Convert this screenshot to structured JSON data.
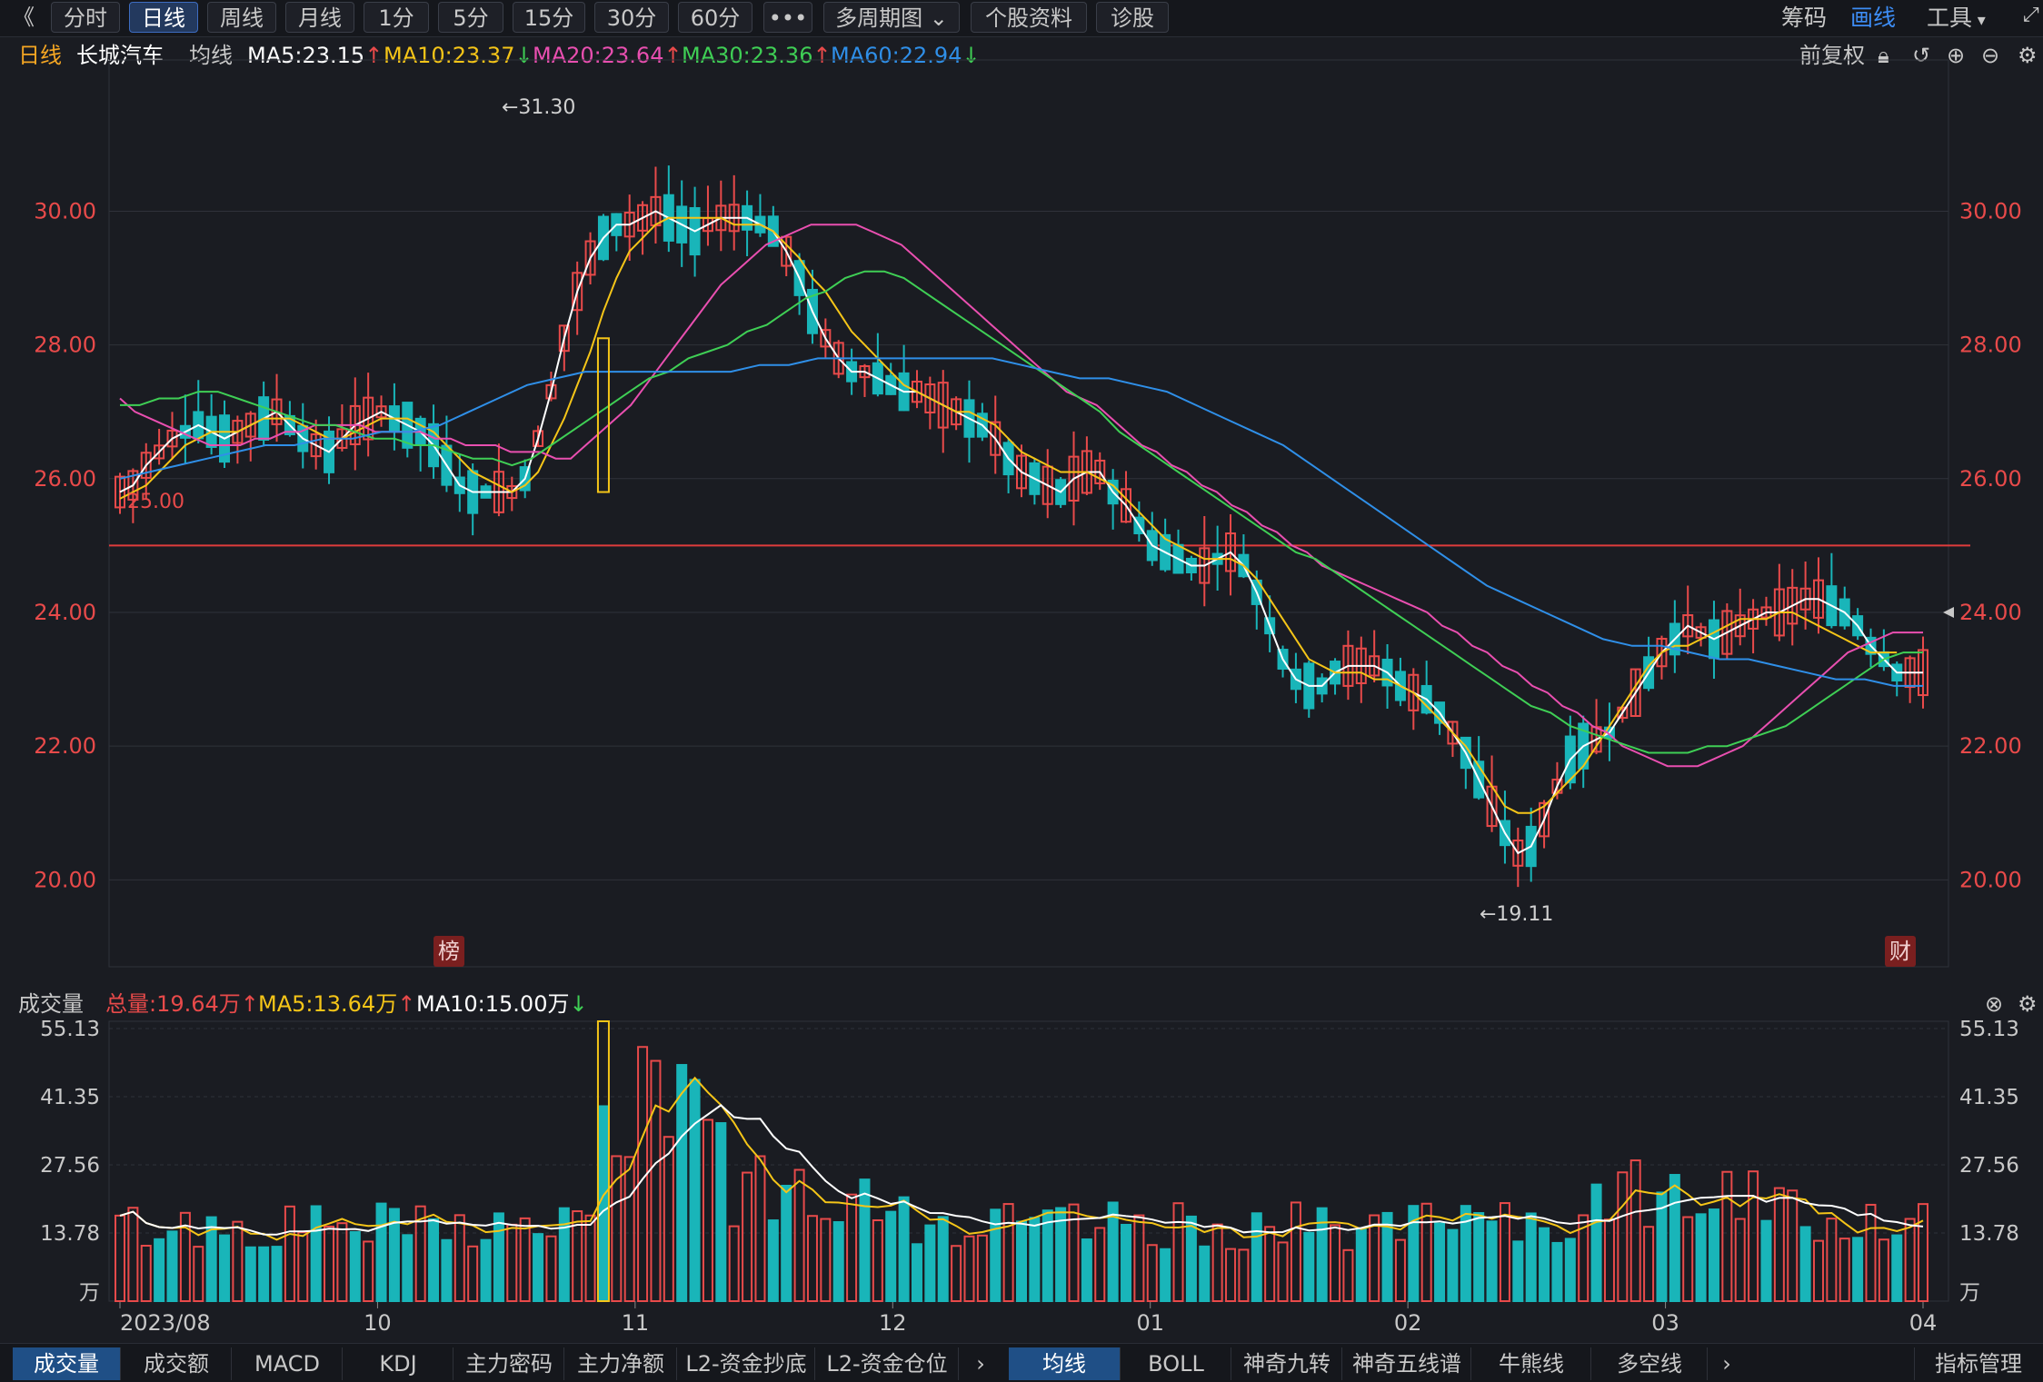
{
  "toolbar": {
    "back_icon": "double-chevron-left-icon",
    "periods": [
      "分时",
      "日线",
      "周线",
      "月线",
      "1分",
      "5分",
      "15分",
      "30分",
      "60分"
    ],
    "active_period": "日线",
    "more_label": "•••",
    "multi_period": "多周期图",
    "stock_info": "个股资料",
    "diagnose": "诊股",
    "right": {
      "chips": "筹码",
      "draw": "画线",
      "tools": "工具"
    }
  },
  "info": {
    "period": "日线",
    "stock_name": "长城汽车",
    "ma_label": "均线",
    "ma5": "MA5:23.15",
    "ma10": "MA10:23.37",
    "ma20": "MA20:23.64",
    "ma30": "MA30:23.36",
    "ma60": "MA60:22.94",
    "adjust": "前复权"
  },
  "price_panel": {
    "hline_label": "25.00",
    "high_label": "←31.30",
    "low_label": "←19.11",
    "badge_rank": "榜",
    "badge_fin": "财"
  },
  "volume_header": {
    "title": "成交量",
    "total": "总量:19.64万",
    "ma5": "MA5:13.64万",
    "ma10": "MA10:15.00万"
  },
  "colors": {
    "up": "#e84a4a",
    "down": "#19b5b9",
    "ma5": "#ffffff",
    "ma10": "#f5c518",
    "ma20": "#e94fb0",
    "ma30": "#3fcf55",
    "ma60": "#2f8fe8",
    "grid": "#2f323a"
  },
  "chart_data": [
    {
      "type": "candlestick",
      "title": "长城汽车 日线",
      "ylim": [
        18.7,
        31.8
      ],
      "y_ticks": [
        "30.00",
        "28.00",
        "26.00",
        "24.00",
        "22.00",
        "20.00"
      ],
      "x_ticks": [
        "2023/08",
        "10",
        "11",
        "12",
        "01",
        "02",
        "03",
        "04"
      ],
      "reference_line": 25.0,
      "annotations": {
        "high": 31.3,
        "low": 19.11
      },
      "series": [
        {
          "name": "MA5",
          "values": [
            25.8,
            25.9,
            26.2,
            26.4,
            26.6,
            26.7,
            26.8,
            26.7,
            26.6,
            26.7,
            26.8,
            26.9,
            27.0,
            26.8,
            26.6,
            26.5,
            26.4,
            26.6,
            26.8,
            26.9,
            27.0,
            26.9,
            26.8,
            26.7,
            26.5,
            26.2,
            25.9,
            25.8,
            25.8,
            25.8,
            25.8,
            26.0,
            26.6,
            27.3,
            28.1,
            28.8,
            29.3,
            29.6,
            29.8,
            29.8,
            29.9,
            30.0,
            29.9,
            29.8,
            29.7,
            29.8,
            29.9,
            29.9,
            29.9,
            29.8,
            29.7,
            29.4,
            29.0,
            28.5,
            28.1,
            27.8,
            27.6,
            27.6,
            27.5,
            27.4,
            27.3,
            27.3,
            27.2,
            27.1,
            27.0,
            26.9,
            26.8,
            26.6,
            26.3,
            26.1,
            26.0,
            25.9,
            25.8,
            26.0,
            26.1,
            26.1,
            25.8,
            25.6,
            25.3,
            25.0,
            24.9,
            24.8,
            24.7,
            24.7,
            24.8,
            24.9,
            24.7,
            24.3,
            23.8,
            23.3,
            23.0,
            22.9,
            22.9,
            23.1,
            23.2,
            23.2,
            23.2,
            23.1,
            22.9,
            22.8,
            22.7,
            22.5,
            22.2,
            21.9,
            21.5,
            21.1,
            20.7,
            20.4,
            20.5,
            20.9,
            21.4,
            21.8,
            22.0,
            22.1,
            22.2,
            22.5,
            22.8,
            23.1,
            23.4,
            23.6,
            23.8,
            23.7,
            23.6,
            23.7,
            23.8,
            23.9,
            24.0,
            24.0,
            24.1,
            24.2,
            24.2,
            24.1,
            24.0,
            23.8,
            23.5,
            23.3,
            23.1,
            23.1,
            23.1
          ]
        },
        {
          "name": "MA10",
          "values": [
            25.7,
            25.8,
            25.9,
            26.1,
            26.3,
            26.5,
            26.6,
            26.7,
            26.7,
            26.7,
            26.8,
            26.9,
            26.9,
            26.9,
            26.8,
            26.7,
            26.6,
            26.6,
            26.7,
            26.8,
            26.9,
            26.9,
            26.9,
            26.8,
            26.7,
            26.5,
            26.3,
            26.1,
            26.0,
            25.9,
            25.8,
            25.9,
            26.1,
            26.5,
            26.9,
            27.4,
            27.9,
            28.5,
            29.0,
            29.4,
            29.6,
            29.8,
            29.9,
            29.9,
            29.9,
            29.9,
            29.9,
            29.8,
            29.8,
            29.8,
            29.7,
            29.5,
            29.3,
            29.0,
            28.8,
            28.5,
            28.2,
            28.0,
            27.8,
            27.6,
            27.4,
            27.3,
            27.2,
            27.1,
            27.0,
            27.0,
            26.9,
            26.8,
            26.6,
            26.4,
            26.3,
            26.2,
            26.1,
            26.1,
            26.1,
            26.0,
            25.9,
            25.7,
            25.5,
            25.3,
            25.1,
            25.0,
            24.9,
            24.8,
            24.8,
            24.8,
            24.7,
            24.5,
            24.2,
            23.9,
            23.6,
            23.3,
            23.2,
            23.1,
            23.1,
            23.1,
            23.0,
            23.0,
            22.9,
            22.8,
            22.6,
            22.4,
            22.2,
            22.0,
            21.7,
            21.4,
            21.1,
            21.0,
            21.0,
            21.1,
            21.3,
            21.5,
            21.7,
            22.0,
            22.3,
            22.6,
            22.9,
            23.2,
            23.4,
            23.5,
            23.5,
            23.6,
            23.7,
            23.8,
            23.9,
            23.9,
            23.9,
            24.0,
            24.0,
            23.9,
            23.8,
            23.7,
            23.6,
            23.5,
            23.4,
            23.4,
            23.4
          ]
        },
        {
          "name": "MA20",
          "values": [
            27.2,
            27.0,
            26.9,
            26.8,
            26.7,
            26.6,
            26.5,
            26.5,
            26.5,
            26.6,
            26.6,
            26.7,
            26.7,
            26.8,
            26.8,
            26.8,
            26.8,
            26.7,
            26.7,
            26.7,
            26.7,
            26.6,
            26.6,
            26.5,
            26.5,
            26.5,
            26.4,
            26.4,
            26.4,
            26.3,
            26.3,
            26.5,
            26.7,
            26.9,
            27.1,
            27.4,
            27.7,
            28.0,
            28.3,
            28.6,
            28.9,
            29.1,
            29.3,
            29.5,
            29.6,
            29.7,
            29.8,
            29.8,
            29.8,
            29.8,
            29.7,
            29.6,
            29.5,
            29.3,
            29.1,
            28.9,
            28.7,
            28.5,
            28.3,
            28.1,
            27.9,
            27.7,
            27.5,
            27.3,
            27.2,
            27.1,
            26.9,
            26.7,
            26.5,
            26.4,
            26.2,
            26.1,
            25.9,
            25.8,
            25.6,
            25.5,
            25.3,
            25.2,
            25.0,
            24.9,
            24.7,
            24.6,
            24.5,
            24.4,
            24.3,
            24.2,
            24.1,
            24.0,
            23.8,
            23.7,
            23.5,
            23.4,
            23.2,
            23.1,
            22.9,
            22.8,
            22.6,
            22.5,
            22.3,
            22.2,
            22.0,
            21.9,
            21.8,
            21.7,
            21.7,
            21.7,
            21.8,
            21.9,
            22.0,
            22.2,
            22.4,
            22.6,
            22.8,
            23.0,
            23.2,
            23.4,
            23.5,
            23.6,
            23.7,
            23.7,
            23.7
          ]
        },
        {
          "name": "MA30",
          "values": [
            27.1,
            27.1,
            27.2,
            27.2,
            27.3,
            27.3,
            27.2,
            27.1,
            27.0,
            26.9,
            26.8,
            26.8,
            26.7,
            26.6,
            26.6,
            26.5,
            26.5,
            26.4,
            26.3,
            26.3,
            26.2,
            26.3,
            26.5,
            26.7,
            26.9,
            27.1,
            27.3,
            27.5,
            27.6,
            27.8,
            27.9,
            28.0,
            28.2,
            28.3,
            28.5,
            28.7,
            28.8,
            29.0,
            29.1,
            29.1,
            29.0,
            28.8,
            28.6,
            28.4,
            28.2,
            28.0,
            27.8,
            27.6,
            27.4,
            27.2,
            27.0,
            26.7,
            26.5,
            26.3,
            26.1,
            25.9,
            25.7,
            25.5,
            25.3,
            25.1,
            24.9,
            24.8,
            24.6,
            24.4,
            24.2,
            24.0,
            23.8,
            23.6,
            23.4,
            23.2,
            23.0,
            22.8,
            22.6,
            22.5,
            22.3,
            22.2,
            22.1,
            22.0,
            21.9,
            21.9,
            21.9,
            22.0,
            22.0,
            22.1,
            22.2,
            22.3,
            22.5,
            22.7,
            22.9,
            23.1,
            23.3,
            23.4,
            23.4
          ]
        },
        {
          "name": "MA60",
          "values": [
            26.0,
            26.1,
            26.2,
            26.3,
            26.4,
            26.5,
            26.5,
            26.6,
            26.6,
            26.7,
            26.7,
            26.8,
            27.0,
            27.2,
            27.4,
            27.5,
            27.6,
            27.6,
            27.6,
            27.6,
            27.6,
            27.6,
            27.7,
            27.7,
            27.8,
            27.8,
            27.8,
            27.8,
            27.8,
            27.8,
            27.8,
            27.7,
            27.6,
            27.5,
            27.5,
            27.4,
            27.3,
            27.1,
            26.9,
            26.7,
            26.5,
            26.2,
            25.9,
            25.6,
            25.3,
            25.0,
            24.7,
            24.4,
            24.2,
            24.0,
            23.8,
            23.6,
            23.5,
            23.5,
            23.4,
            23.3,
            23.3,
            23.2,
            23.1,
            23.0,
            23.0,
            22.9,
            22.9
          ]
        }
      ]
    },
    {
      "type": "bar",
      "title": "成交量",
      "ylim": [
        0,
        55.13
      ],
      "y_ticks": [
        "55.13",
        "41.35",
        "27.56",
        "13.78"
      ],
      "unit": "万",
      "x_ticks": [
        "2023/08",
        "10",
        "11",
        "12",
        "01",
        "02",
        "03",
        "04"
      ],
      "volume_ma5_last": 13.64,
      "volume_ma10_last": 15.0,
      "total_last": 19.64
    }
  ],
  "bottom": {
    "tabs_left": [
      "成交量",
      "成交额",
      "MACD",
      "KDJ",
      "主力密码",
      "主力净额",
      "L2-资金抄底",
      "L2-资金仓位"
    ],
    "tabs_right": [
      "均线",
      "BOLL",
      "神奇九转",
      "神奇五线谱",
      "牛熊线",
      "多空线"
    ],
    "manage": "指标管理"
  }
}
